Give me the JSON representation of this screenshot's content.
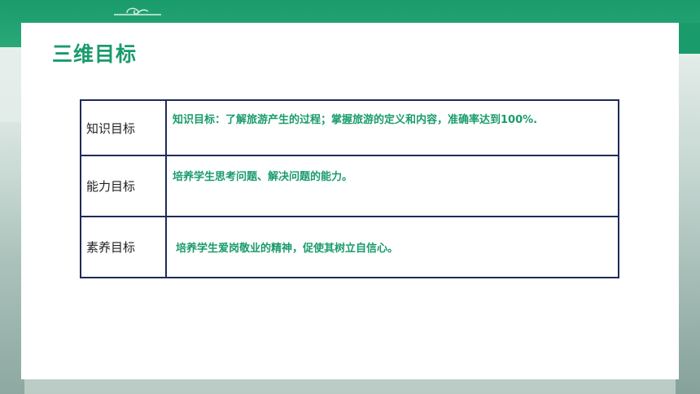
{
  "slide": {
    "title": "三维目标",
    "rows": [
      {
        "label": "知识目标",
        "content": "知识目标：了解旅游产生的过程；掌握旅游的定义和内容，准确率达到100%."
      },
      {
        "label": "能力目标",
        "content": "培养学生思考问题、解决问题的能力。"
      },
      {
        "label": "素养目标",
        "content": "培养学生爱岗敬业的精神，促使其树立自信心。"
      }
    ]
  },
  "colors": {
    "accent": "#1a9b6c",
    "table_border": "#1f2a5a",
    "label_text": "#222222"
  },
  "icons": {
    "top_ornament": "cloud-scroll-ornament"
  }
}
